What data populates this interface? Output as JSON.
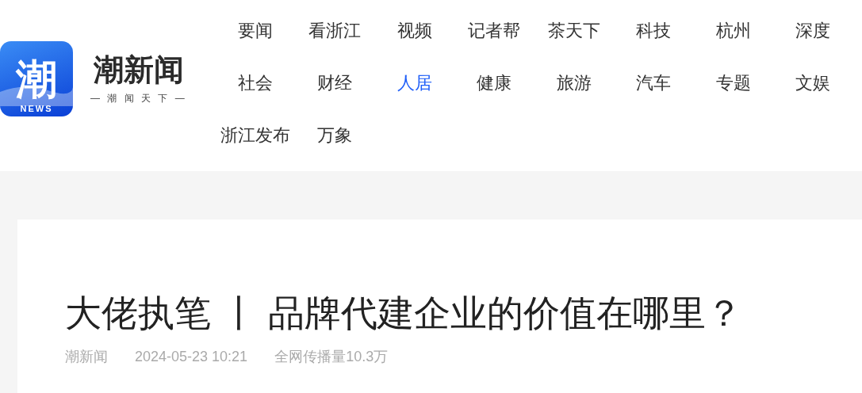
{
  "logo": {
    "icon_char": "潮",
    "icon_caption": "NEWS",
    "name": "潮新闻",
    "tagline": "— 潮 闻 天 下 —"
  },
  "nav": [
    {
      "label": "要闻",
      "selected": false
    },
    {
      "label": "看浙江",
      "selected": false
    },
    {
      "label": "视频",
      "selected": false
    },
    {
      "label": "记者帮",
      "selected": false
    },
    {
      "label": "茶天下",
      "selected": false
    },
    {
      "label": "科技",
      "selected": false
    },
    {
      "label": "杭州",
      "selected": false
    },
    {
      "label": "深度",
      "selected": false
    },
    {
      "label": "社会",
      "selected": false
    },
    {
      "label": "财经",
      "selected": false
    },
    {
      "label": "人居",
      "selected": true
    },
    {
      "label": "健康",
      "selected": false
    },
    {
      "label": "旅游",
      "selected": false
    },
    {
      "label": "汽车",
      "selected": false
    },
    {
      "label": "专题",
      "selected": false
    },
    {
      "label": "文娱",
      "selected": false
    },
    {
      "label": "浙江发布",
      "selected": false
    },
    {
      "label": "万象",
      "selected": false
    }
  ],
  "article": {
    "title": "大佬执笔 丨 品牌代建企业的价值在哪里？",
    "source": "潮新闻",
    "time": "2024-05-23 10:21",
    "views": "全网传播量10.3万"
  }
}
